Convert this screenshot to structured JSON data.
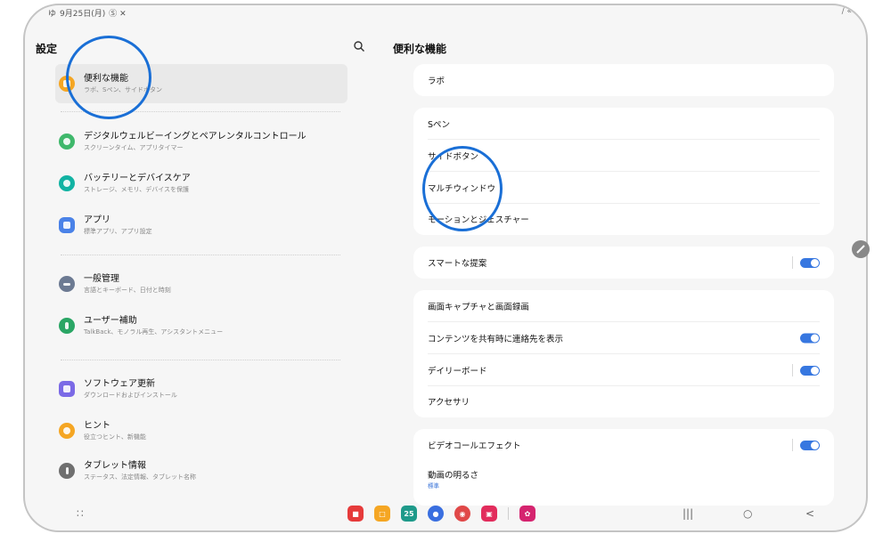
{
  "status_bar": {
    "left_prefix": "ゆ",
    "date": "9月25日(月)",
    "icons": "Ⓢ ✕",
    "right": "∕ «"
  },
  "left_pane": {
    "title": "設定",
    "search_icon": "search-icon",
    "items": [
      {
        "title": "便利な機能",
        "sub": "ラボ、Sペン、サイドボタン",
        "icon_color": "#f5a623",
        "selected": true
      },
      {
        "title": "デジタルウェルビーイングとペアレンタルコントロール",
        "sub": "スクリーンタイム、アプリタイマー",
        "icon_color": "#3fb86b"
      },
      {
        "title": "バッテリーとデバイスケア",
        "sub": "ストレージ、メモリ、デバイスを保護",
        "icon_color": "#12b3a3"
      },
      {
        "title": "アプリ",
        "sub": "標準アプリ、アプリ設定",
        "icon_color": "#4a82e8"
      },
      {
        "title": "一般管理",
        "sub": "言語とキーボード、日付と時刻",
        "icon_color": "#6c7a92"
      },
      {
        "title": "ユーザー補助",
        "sub": "TalkBack、モノラル再生、アシスタントメニュー",
        "icon_color": "#2aa665"
      },
      {
        "title": "ソフトウェア更新",
        "sub": "ダウンロードおよびインストール",
        "icon_color": "#7b6ae6"
      },
      {
        "title": "ヒント",
        "sub": "役立つヒント、新機能",
        "icon_color": "#f5a623"
      },
      {
        "title": "タブレット情報",
        "sub": "ステータス、法定情報、タブレット名称",
        "icon_color": "#6f6f6f"
      }
    ]
  },
  "right_pane": {
    "title": "便利な機能",
    "card1": {
      "row1": "ラボ"
    },
    "card2": {
      "row1": "Sペン",
      "row2": "サイドボタン",
      "row3": "マルチウィンドウ",
      "row4": "モーションとジェスチャー"
    },
    "card3": {
      "row1": "スマートな提案",
      "toggle1": true
    },
    "card4": {
      "row1": "画面キャプチャと画面録画",
      "row2": "コンテンツを共有時に連絡先を表示",
      "row3": "デイリーボード",
      "row4": "アクセサリ",
      "toggle2": true,
      "toggle3": true
    },
    "card5": {
      "row1": "ビデオコールエフェクト",
      "row2": "動画の明るさ",
      "row2_sub": "標準",
      "toggle4": true
    }
  },
  "dock": {
    "apps_button": "∷",
    "apps": [
      {
        "name": "app-red",
        "color": "#e63b3b",
        "label": "■"
      },
      {
        "name": "app-files",
        "color": "#f5a623",
        "label": "□"
      },
      {
        "name": "app-calendar",
        "color": "#1f9a8a",
        "label": "25"
      },
      {
        "name": "app-messages",
        "color": "#3a6fe0",
        "label": "●"
      },
      {
        "name": "app-chrome",
        "color": "#e04848",
        "label": "◉"
      },
      {
        "name": "app-camera",
        "color": "#e22c5c",
        "label": "▣"
      },
      {
        "name": "app-flower",
        "color": "#d5246f",
        "label": "✿"
      }
    ],
    "nav_recent": "|||",
    "nav_home": "○",
    "nav_back": "<"
  },
  "colors": {
    "accent": "#3777e0",
    "annotation": "#1a6fd6"
  }
}
